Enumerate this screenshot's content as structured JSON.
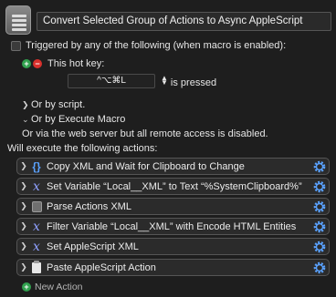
{
  "header": {
    "macro_icon": "macro-document-icon",
    "title": "Convert Selected Group of Actions to Async AppleScript"
  },
  "triggers": {
    "enabled_label": "Triggered by any of the following (when macro is enabled):",
    "hotkey_label": "This hot key:",
    "hotkey_value": "^⌥⌘L",
    "pressed_label": "is pressed",
    "or_script": "Or by script.",
    "or_execute_macro": "Or by Execute Macro",
    "web_note": "Or via the web server but all remote access is disabled."
  },
  "actions_header": "Will execute the following actions:",
  "actions": [
    {
      "label": "Copy XML and Wait for Clipboard to Change",
      "icon": "curly-braces-icon"
    },
    {
      "label": "Set Variable “Local__XML” to Text “%SystemClipboard%”",
      "icon": "variable-x-icon"
    },
    {
      "label": "Parse Actions XML",
      "icon": "macro-list-icon"
    },
    {
      "label": "Filter Variable “Local__XML” with Encode HTML Entities",
      "icon": "variable-x-icon"
    },
    {
      "label": "Set AppleScript XML",
      "icon": "variable-x-icon"
    },
    {
      "label": "Paste AppleScript Action",
      "icon": "paste-clipboard-icon"
    }
  ],
  "new_action_label": "New Action",
  "colors": {
    "accent_blue": "#5aa2ff",
    "plus_green": "#30a14e",
    "minus_red": "#d9302c"
  }
}
